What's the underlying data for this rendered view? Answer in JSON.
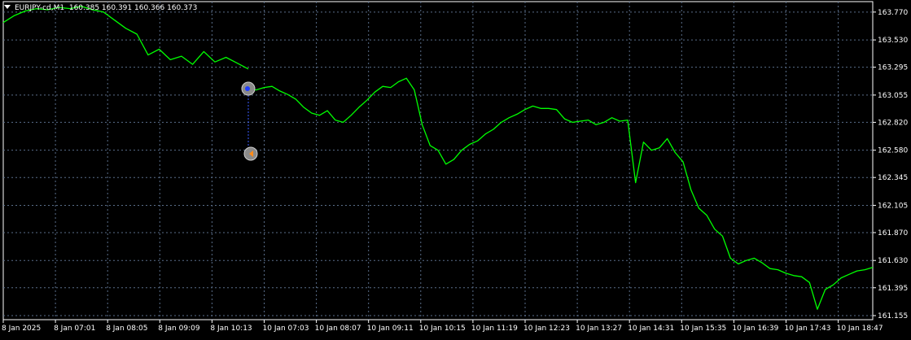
{
  "header": {
    "symbol": "EURJPY-cd,M1",
    "ohlc": "160.385 160.391 160.366 160.373"
  },
  "colors": {
    "background": "#000000",
    "line": "#00ff00",
    "grid": "#5a6e8a",
    "axis": "#ffffff",
    "marker": "#8a8a8a",
    "connector": "#3a5cff"
  },
  "chart_data": {
    "type": "line",
    "title": "EURJPY-cd,M1",
    "xlabel": "",
    "ylabel": "",
    "grid": true,
    "y_ticks": [
      "163.770",
      "163.530",
      "163.295",
      "163.055",
      "162.820",
      "162.580",
      "162.345",
      "162.105",
      "161.870",
      "161.630",
      "161.395",
      "161.155"
    ],
    "x_ticks": [
      "8 Jan 2025",
      "8 Jan 07:01",
      "8 Jan 08:05",
      "8 Jan 09:09",
      "8 Jan 10:13",
      "10 Jan 07:03",
      "10 Jan 08:07",
      "10 Jan 09:11",
      "10 Jan 10:15",
      "10 Jan 11:19",
      "10 Jan 12:23",
      "10 Jan 13:27",
      "10 Jan 14:31",
      "10 Jan 15:35",
      "10 Jan 16:39",
      "10 Jan 17:43",
      "10 Jan 18:47"
    ],
    "ylim": [
      161.12,
      163.86
    ],
    "series": [
      {
        "values": [
          163.68,
          163.74,
          163.78,
          163.8,
          163.79,
          163.81,
          163.8,
          163.82,
          163.79,
          163.77,
          163.7,
          163.63,
          163.58,
          163.4,
          163.45,
          163.36,
          163.39,
          163.32,
          163.43,
          163.34,
          163.38,
          163.33,
          163.28,
          163.1,
          163.1,
          163.12,
          163.13,
          163.09,
          163.06,
          163.02,
          162.95,
          162.9,
          162.88,
          162.92,
          162.84,
          162.82,
          162.88,
          162.95,
          163.01,
          163.08,
          163.13,
          163.12,
          163.17,
          163.2,
          163.1,
          162.8,
          162.62,
          162.58,
          162.46,
          162.5,
          162.58,
          162.63,
          162.66,
          162.72,
          162.76,
          162.82,
          162.86,
          162.89,
          162.93,
          162.96,
          162.94,
          162.94,
          162.93,
          162.85,
          162.82,
          162.83,
          162.84,
          162.8,
          162.82,
          162.86,
          162.83,
          162.84,
          162.3,
          162.65,
          162.58,
          162.6,
          162.68,
          162.56,
          162.48,
          162.24,
          162.08,
          162.02,
          161.9,
          161.84,
          161.65,
          161.6,
          161.63,
          161.65,
          161.61,
          161.56,
          161.55,
          161.52,
          161.5,
          161.49,
          161.44,
          161.21,
          161.38,
          161.42,
          161.48,
          161.51,
          161.54,
          161.55,
          161.57
        ]
      }
    ],
    "annotations": [
      {
        "kind": "entry-marker",
        "price": 163.11
      },
      {
        "kind": "exit-marker",
        "price": 162.55
      }
    ]
  }
}
